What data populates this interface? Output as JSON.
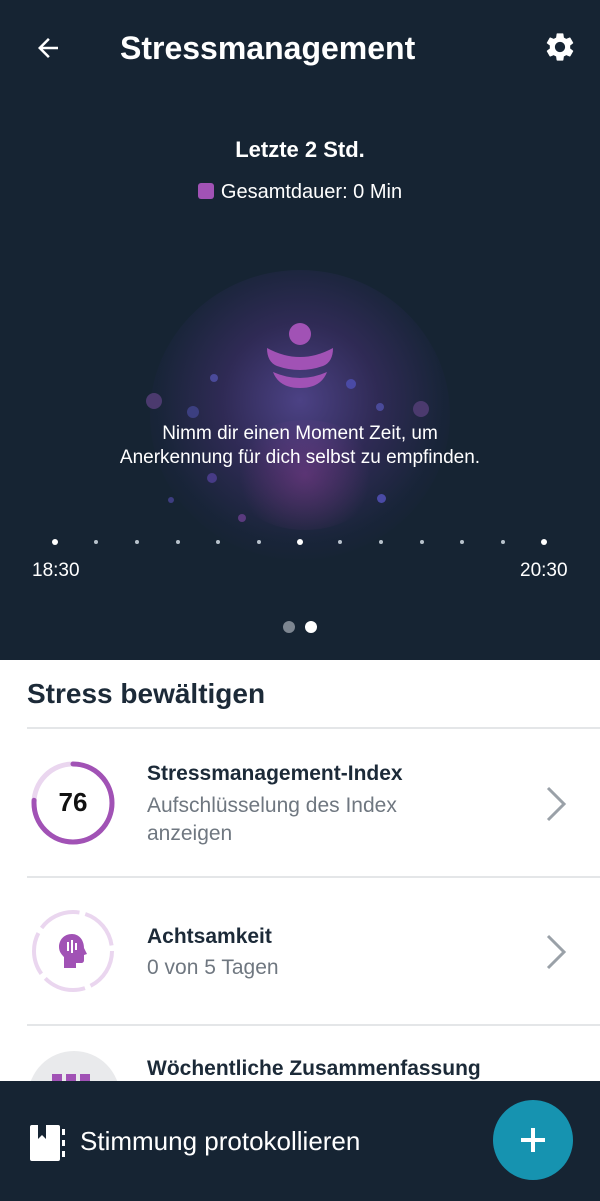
{
  "header": {
    "title": "Stressmanagement",
    "back_icon": "arrow-left-icon",
    "settings_icon": "gear-icon"
  },
  "summary": {
    "period": "Letzte 2 Std.",
    "legend_label": "Gesamtdauer: 0 Min",
    "legend_color": "#a152b5",
    "message_line1": "Nimm dir einen Moment Zeit, um",
    "message_line2": "Anerkennung für dich selbst zu empfinden.",
    "time_start": "18:30",
    "time_end": "20:30",
    "pager": {
      "count": 2,
      "active": 2
    }
  },
  "section": {
    "title": "Stress bewältigen",
    "items": [
      {
        "title": "Stressmanagement-Index",
        "subtitle_line1": "Aufschlüsselung des Index",
        "subtitle_line2": "anzeigen",
        "score": "76",
        "score_fraction": 0.76
      },
      {
        "title": "Achtsamkeit",
        "subtitle": "0 von 5 Tagen",
        "icon": "mindfulness-head-icon"
      },
      {
        "title": "Wöchentliche Zusammenfassung",
        "icon": "calendar-icon"
      }
    ]
  },
  "bottom_bar": {
    "label": "Stimmung protokollieren",
    "icon": "journal-icon",
    "fab_icon": "plus-icon"
  },
  "colors": {
    "dark_bg": "#162433",
    "accent_purple": "#a152b5",
    "fab": "#1693b0"
  }
}
